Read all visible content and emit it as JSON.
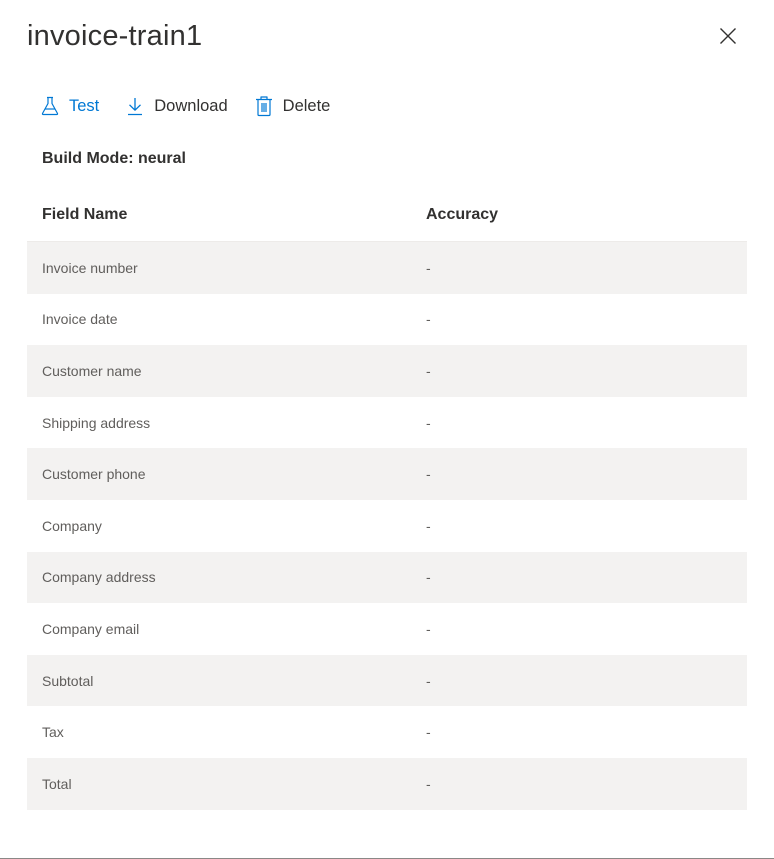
{
  "panel": {
    "title": "invoice-train1",
    "close_label": "Close"
  },
  "toolbar": {
    "test_label": "Test",
    "download_label": "Download",
    "delete_label": "Delete"
  },
  "build_mode": "Build Mode: neural",
  "table": {
    "headers": [
      "Field Name",
      "Accuracy"
    ],
    "rows": [
      {
        "field": "Invoice number",
        "accuracy": "-"
      },
      {
        "field": "Invoice date",
        "accuracy": "-"
      },
      {
        "field": "Customer name",
        "accuracy": "-"
      },
      {
        "field": "Shipping address",
        "accuracy": "-"
      },
      {
        "field": "Customer phone",
        "accuracy": "-"
      },
      {
        "field": "Company",
        "accuracy": "-"
      },
      {
        "field": "Company address",
        "accuracy": "-"
      },
      {
        "field": "Company email",
        "accuracy": "-"
      },
      {
        "field": "Subtotal",
        "accuracy": "-"
      },
      {
        "field": "Tax",
        "accuracy": "-"
      },
      {
        "field": "Total",
        "accuracy": "-"
      }
    ]
  },
  "colors": {
    "accent": "#0078d4",
    "row_alt": "#f3f2f1",
    "text_primary": "#323130",
    "text_secondary": "#605e5c"
  },
  "icons": {
    "test": "beaker-icon",
    "download": "download-icon",
    "delete": "trash-icon",
    "close": "close-icon"
  }
}
